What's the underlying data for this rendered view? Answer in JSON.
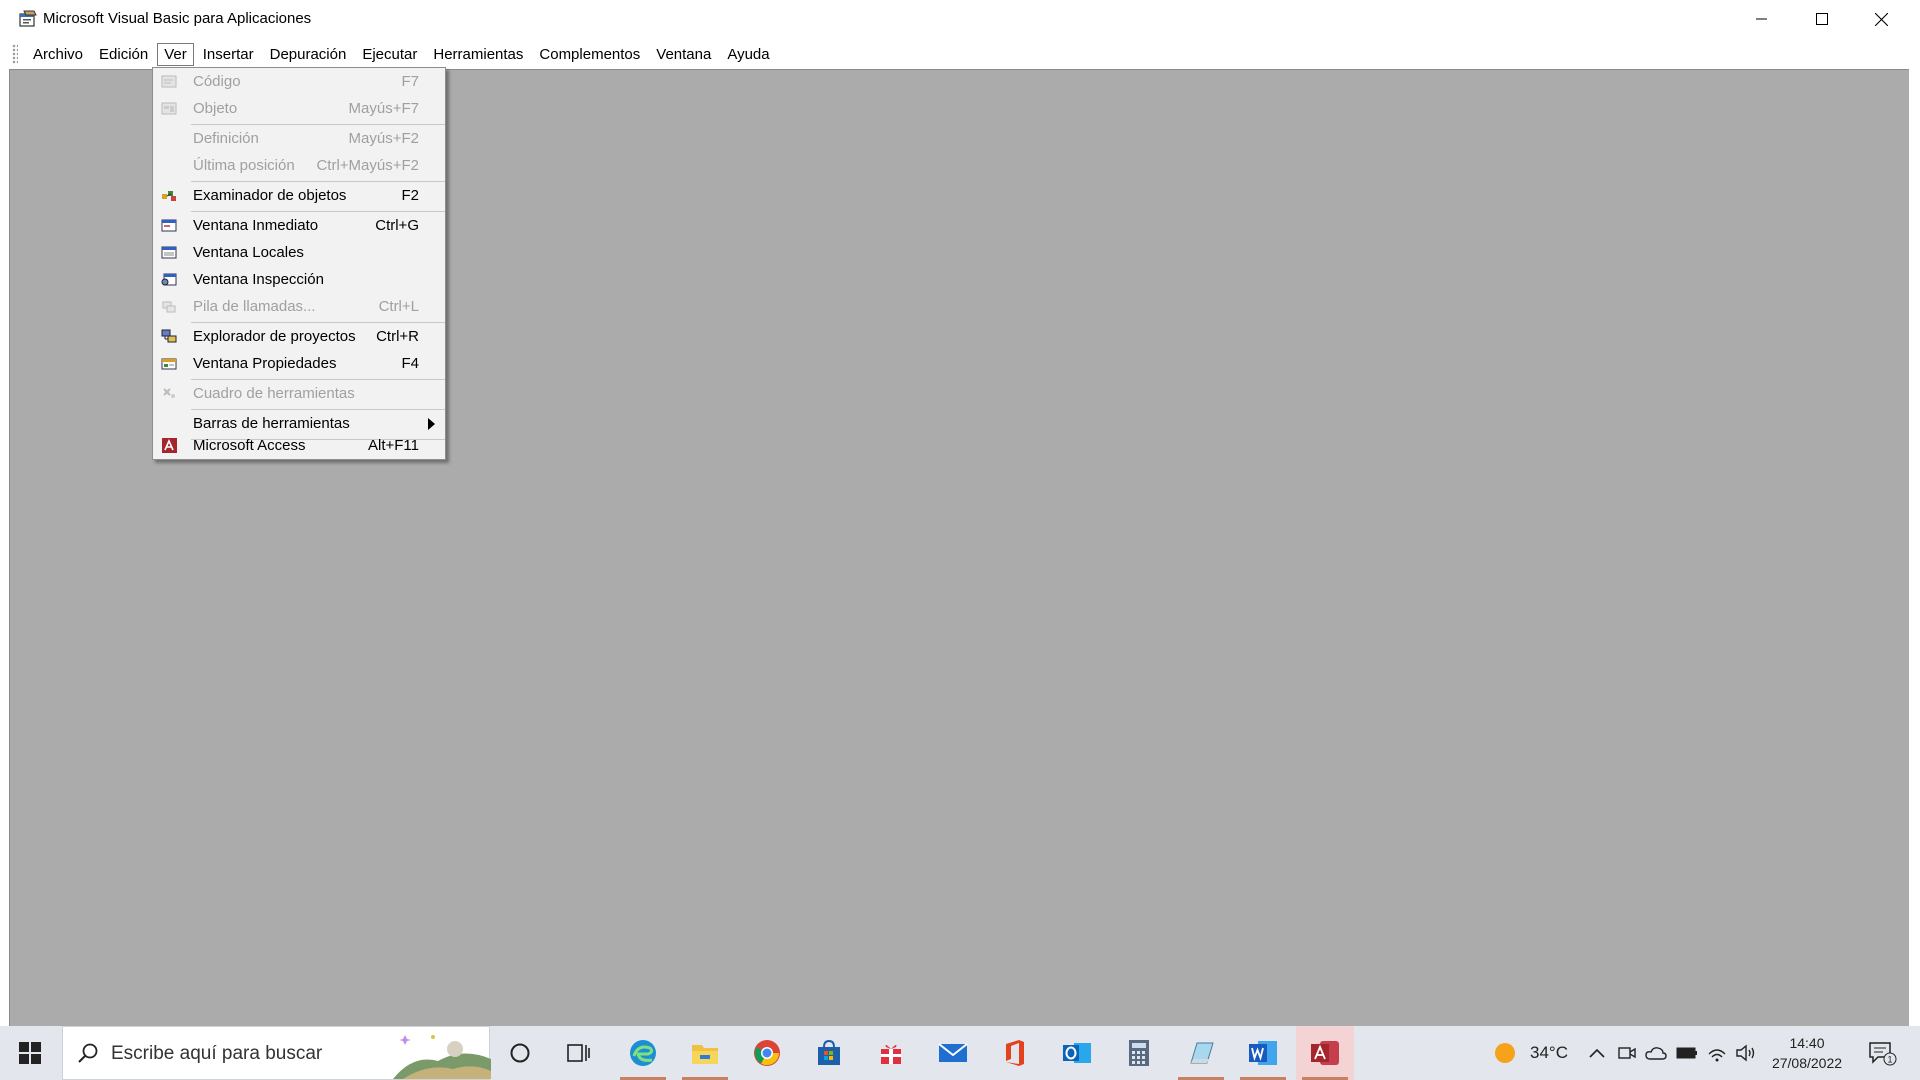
{
  "window": {
    "title": "Microsoft Visual Basic para Aplicaciones"
  },
  "menubar": {
    "items": [
      {
        "label": "Archivo"
      },
      {
        "label": "Edición"
      },
      {
        "label": "Ver"
      },
      {
        "label": "Insertar"
      },
      {
        "label": "Depuración"
      },
      {
        "label": "Ejecutar"
      },
      {
        "label": "Herramientas"
      },
      {
        "label": "Complementos"
      },
      {
        "label": "Ventana"
      },
      {
        "label": "Ayuda"
      }
    ],
    "open_menu": "Ver"
  },
  "dropdown": {
    "items": [
      {
        "label": "Código",
        "shortcut": "F7",
        "enabled": false,
        "icon": "code-icon"
      },
      {
        "label": "Objeto",
        "shortcut": "Mayús+F7",
        "enabled": false,
        "icon": "object-icon"
      },
      {
        "label": "Definición",
        "shortcut": "Mayús+F2",
        "enabled": false,
        "icon": ""
      },
      {
        "label": "Última posición",
        "shortcut": "Ctrl+Mayús+F2",
        "enabled": false,
        "icon": ""
      },
      {
        "label": "Examinador de objetos",
        "shortcut": "F2",
        "enabled": true,
        "icon": "object-browser-icon"
      },
      {
        "label": "Ventana Inmediato",
        "shortcut": "Ctrl+G",
        "enabled": true,
        "icon": "immediate-window-icon"
      },
      {
        "label": "Ventana Locales",
        "shortcut": "",
        "enabled": true,
        "icon": "locals-window-icon"
      },
      {
        "label": "Ventana Inspección",
        "shortcut": "",
        "enabled": true,
        "icon": "watch-window-icon"
      },
      {
        "label": "Pila de llamadas...",
        "shortcut": "Ctrl+L",
        "enabled": false,
        "icon": "call-stack-icon"
      },
      {
        "label": "Explorador de proyectos",
        "shortcut": "Ctrl+R",
        "enabled": true,
        "icon": "project-explorer-icon"
      },
      {
        "label": "Ventana Propiedades",
        "shortcut": "F4",
        "enabled": true,
        "icon": "properties-window-icon"
      },
      {
        "label": "Cuadro de herramientas",
        "shortcut": "",
        "enabled": false,
        "icon": "toolbox-icon"
      },
      {
        "label": "Barras de herramientas",
        "shortcut": "",
        "enabled": true,
        "icon": "",
        "submenu": true
      },
      {
        "label": "Microsoft Access",
        "shortcut": "Alt+F11",
        "enabled": true,
        "icon": "microsoft-access-icon"
      }
    ]
  },
  "taskbar": {
    "search_placeholder": "Escribe aquí para buscar",
    "apps": [
      "task-view",
      "edge",
      "file-explorer",
      "chrome",
      "microsoft-store",
      "gift",
      "mail",
      "office",
      "outlook",
      "calculator",
      "notepad",
      "word",
      "access"
    ],
    "temperature": "34°C",
    "time": "14:40",
    "date": "27/08/2022",
    "notification_count": "1"
  },
  "colors": {
    "client_area": "#ababab",
    "menu_bg": "#f2f2f2",
    "disabled_text": "#a0a0a0",
    "taskbar_bg": "#e3e7ed"
  }
}
